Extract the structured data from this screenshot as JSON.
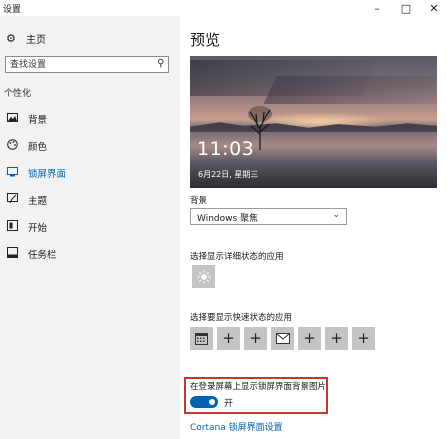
{
  "window": {
    "title": "设置",
    "minimize_label": "–",
    "maximize_label": "□",
    "close_label": "✕"
  },
  "sidebar": {
    "home_label": "主页",
    "search_placeholder": "查找设置",
    "section_label": "个性化",
    "items": [
      {
        "label": "背景",
        "icon": "image-icon"
      },
      {
        "label": "颜色",
        "icon": "palette-icon"
      },
      {
        "label": "锁屏界面",
        "icon": "lock-screen-icon",
        "active": true
      },
      {
        "label": "主题",
        "icon": "theme-icon"
      },
      {
        "label": "开始",
        "icon": "start-icon"
      },
      {
        "label": "任务栏",
        "icon": "taskbar-icon"
      }
    ]
  },
  "main": {
    "title": "预览",
    "preview": {
      "time": "11:03",
      "date": "6月22日, 星期三"
    },
    "background_label": "背景",
    "background_value": "Windows 聚焦",
    "detail_status_label": "选择显示详细状态的应用",
    "quick_status_label": "选择要显示快速状态的应用",
    "quick_tiles": [
      "calendar-icon",
      "plus-icon",
      "plus-icon",
      "mail-icon",
      "plus-icon",
      "plus-icon",
      "plus-icon"
    ],
    "signin_bg_label": "在登录屏幕上显示锁屏界面背景图片",
    "signin_bg_state": "开",
    "signin_bg_on": true,
    "cortana_link": "Cortana 锁屏界面设置"
  },
  "colors": {
    "accent": "#0063b1",
    "sidebar_bg": "#f2f2f2",
    "tile_bg": "#c4c4c4",
    "highlight": "#c0392b"
  }
}
